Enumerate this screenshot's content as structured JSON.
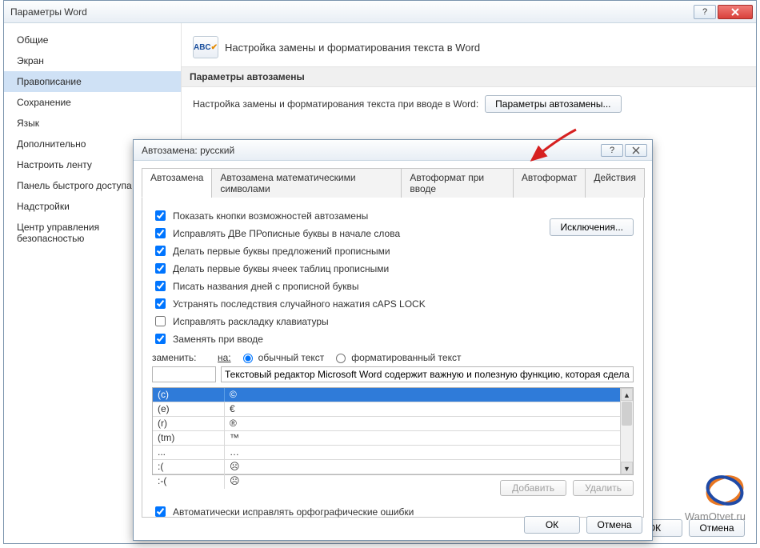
{
  "main": {
    "title": "Параметры Word",
    "nav": [
      "Общие",
      "Экран",
      "Правописание",
      "Сохранение",
      "Язык",
      "Дополнительно",
      "Настроить ленту",
      "Панель быстрого доступа",
      "Надстройки",
      "Центр управления безопасностью"
    ],
    "nav_selected_index": 2,
    "header_label": "Настройка замены и форматирования текста в Word",
    "section1": "Параметры автозамены",
    "opt_text": "Настройка замены и форматирования текста при вводе в Word:",
    "opt_btn": "Параметры автозамены...",
    "footer_ok": "ОК",
    "footer_cancel": "Отмена"
  },
  "dlg": {
    "title": "Автозамена: русский",
    "tabs": [
      "Автозамена",
      "Автозамена математическими символами",
      "Автоформат при вводе",
      "Автоформат",
      "Действия"
    ],
    "active_tab": 0,
    "checks": [
      {
        "label": "Показать кнопки возможностей автозамены",
        "checked": true
      },
      {
        "label": "Исправлять ДВе ПРописные буквы в начале слова",
        "checked": true
      },
      {
        "label": "Делать первые буквы предложений прописными",
        "checked": true
      },
      {
        "label": "Делать первые буквы ячеек таблиц прописными",
        "checked": true
      },
      {
        "label": "Писать названия дней с прописной буквы",
        "checked": true
      },
      {
        "label": "Устранять последствия случайного нажатия cAPS LOCK",
        "checked": true
      },
      {
        "label": "Исправлять раскладку клавиатуры",
        "checked": false
      },
      {
        "label": "Заменять при вводе",
        "checked": true
      }
    ],
    "exceptions_btn": "Исключения...",
    "replace_label": "заменить:",
    "on_label": "на:",
    "radio_plain": "обычный текст",
    "radio_fmt": "форматированный текст",
    "radio_selected": 0,
    "replace_input": "",
    "with_input": "Текстовый редактор Microsoft Word содержит важную и полезную функцию, которая сделает",
    "table": [
      {
        "from": "(c)",
        "to": "©"
      },
      {
        "from": "(e)",
        "to": "€"
      },
      {
        "from": "(r)",
        "to": "®"
      },
      {
        "from": "(tm)",
        "to": "™"
      },
      {
        "from": "...",
        "to": "…"
      },
      {
        "from": ":(",
        "to": "☹"
      },
      {
        "from": ":-(",
        "to": "☹"
      }
    ],
    "table_selected": 0,
    "add_btn": "Добавить",
    "delete_btn": "Удалить",
    "auto_spell": "Автоматически исправлять орфографические ошибки",
    "auto_spell_checked": true,
    "ok": "ОК",
    "cancel": "Отмена"
  },
  "watermark": "WamOtvet.ru"
}
